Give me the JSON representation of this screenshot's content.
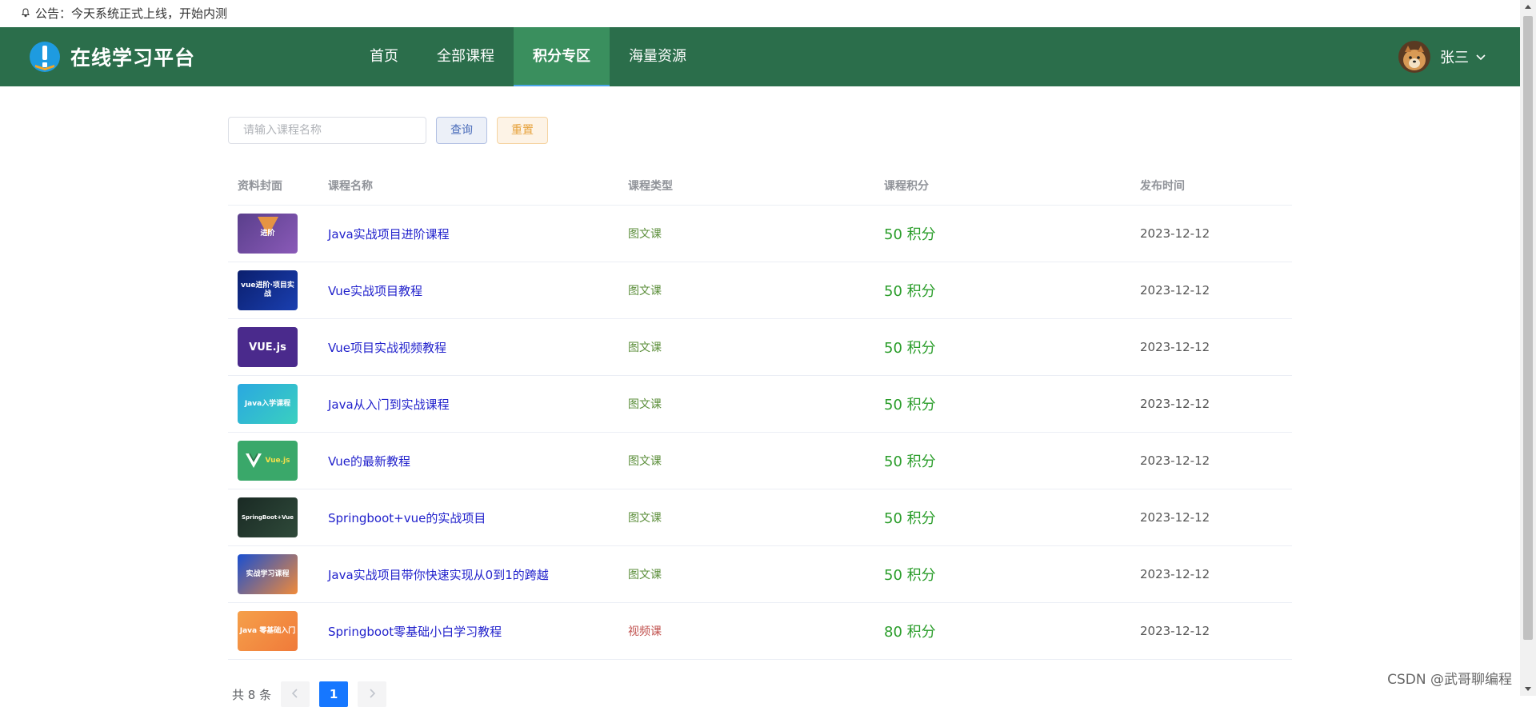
{
  "notice": {
    "text": "公告：今天系统正式上线，开始内测"
  },
  "header": {
    "logo_text": "在线学习平台",
    "nav": [
      "首页",
      "全部课程",
      "积分专区",
      "海量资源"
    ],
    "active_nav": "积分专区",
    "user_name": "张三"
  },
  "search": {
    "placeholder": "请输入课程名称",
    "query_label": "查询",
    "reset_label": "重置"
  },
  "table": {
    "headers": [
      "资料封面",
      "课程名称",
      "课程类型",
      "课程积分",
      "发布时间"
    ],
    "rows": [
      {
        "cover": "进阶",
        "name": "Java实战项目进阶课程",
        "type": "图文课",
        "points": "50 积分",
        "date": "2023-12-12"
      },
      {
        "cover": "vue进阶·项目实战",
        "name": "Vue实战项目教程",
        "type": "图文课",
        "points": "50 积分",
        "date": "2023-12-12"
      },
      {
        "cover": "VUE.js",
        "name": "Vue项目实战视频教程",
        "type": "图文课",
        "points": "50 积分",
        "date": "2023-12-12"
      },
      {
        "cover": "Java入学课程",
        "name": "Java从入门到实战课程",
        "type": "图文课",
        "points": "50 积分",
        "date": "2023-12-12"
      },
      {
        "cover": "Vue.js",
        "name": "Vue的最新教程",
        "type": "图文课",
        "points": "50 积分",
        "date": "2023-12-12"
      },
      {
        "cover": "SpringBoot+Vue",
        "name": "Springboot+vue的实战项目",
        "type": "图文课",
        "points": "50 积分",
        "date": "2023-12-12"
      },
      {
        "cover": "实战学习课程",
        "name": "Java实战项目带你快速实现从0到1的跨越",
        "type": "图文课",
        "points": "50 积分",
        "date": "2023-12-12"
      },
      {
        "cover": "Java 零基础入门",
        "name": "Springboot零基础小白学习教程",
        "type": "视频课",
        "points": "80 积分",
        "date": "2023-12-12"
      }
    ]
  },
  "pager": {
    "total": "共 8 条",
    "current": "1"
  },
  "watermark": "CSDN @武哥聊编程",
  "colors": {
    "header_bg": "#2b6e4b",
    "nav_active": "#3a8f5e",
    "points": "#2a9d2a",
    "link": "#2222cc",
    "page_active": "#1677ff"
  }
}
